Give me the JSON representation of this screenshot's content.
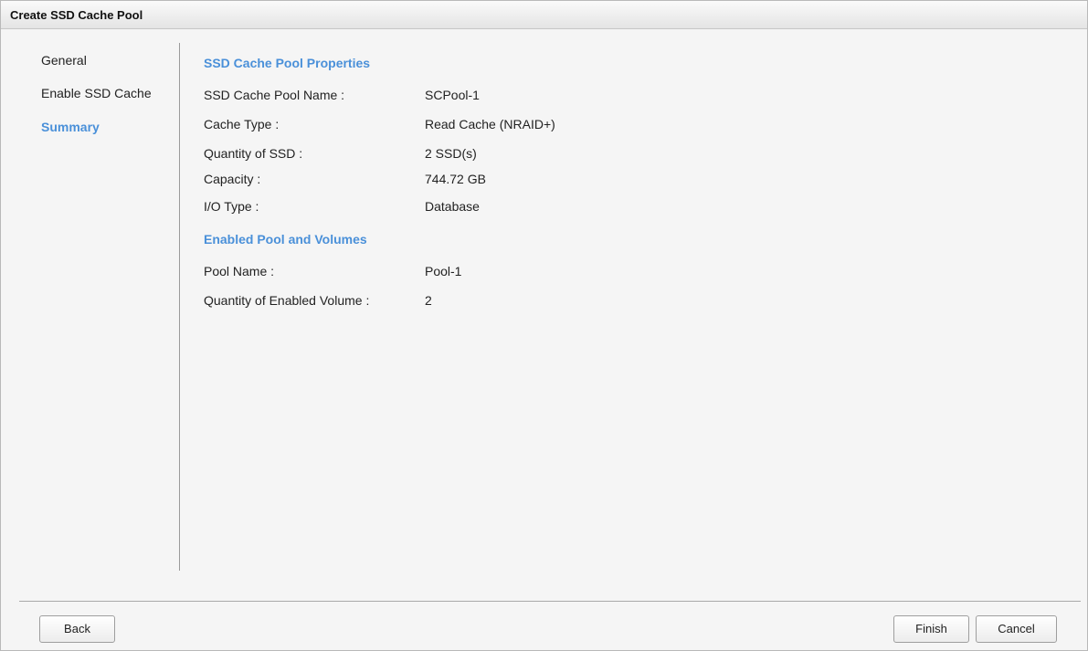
{
  "dialog": {
    "title": "Create SSD Cache Pool"
  },
  "nav": {
    "items": [
      {
        "label": "General",
        "active": false
      },
      {
        "label": "Enable SSD Cache",
        "active": false
      },
      {
        "label": "Summary",
        "active": true
      }
    ]
  },
  "summary": {
    "properties_title": "SSD Cache Pool Properties",
    "properties": [
      {
        "label": "SSD Cache Pool Name :",
        "value": "SCPool-1"
      },
      {
        "label": "Cache Type :",
        "value": "Read Cache (NRAID+)"
      },
      {
        "label": "Quantity of SSD :",
        "value": "2 SSD(s)"
      },
      {
        "label": "Capacity :",
        "value": "744.72 GB"
      },
      {
        "label": "I/O Type :",
        "value": "Database"
      }
    ],
    "pools_title": "Enabled Pool and Volumes",
    "pools": [
      {
        "label": "Pool Name :",
        "value": "Pool-1"
      },
      {
        "label": "Quantity of Enabled Volume :",
        "value": "2"
      }
    ]
  },
  "footer": {
    "back_label": "Back",
    "finish_label": "Finish",
    "cancel_label": "Cancel"
  },
  "colors": {
    "accent": "#4a90d9",
    "background": "#f5f5f5"
  }
}
